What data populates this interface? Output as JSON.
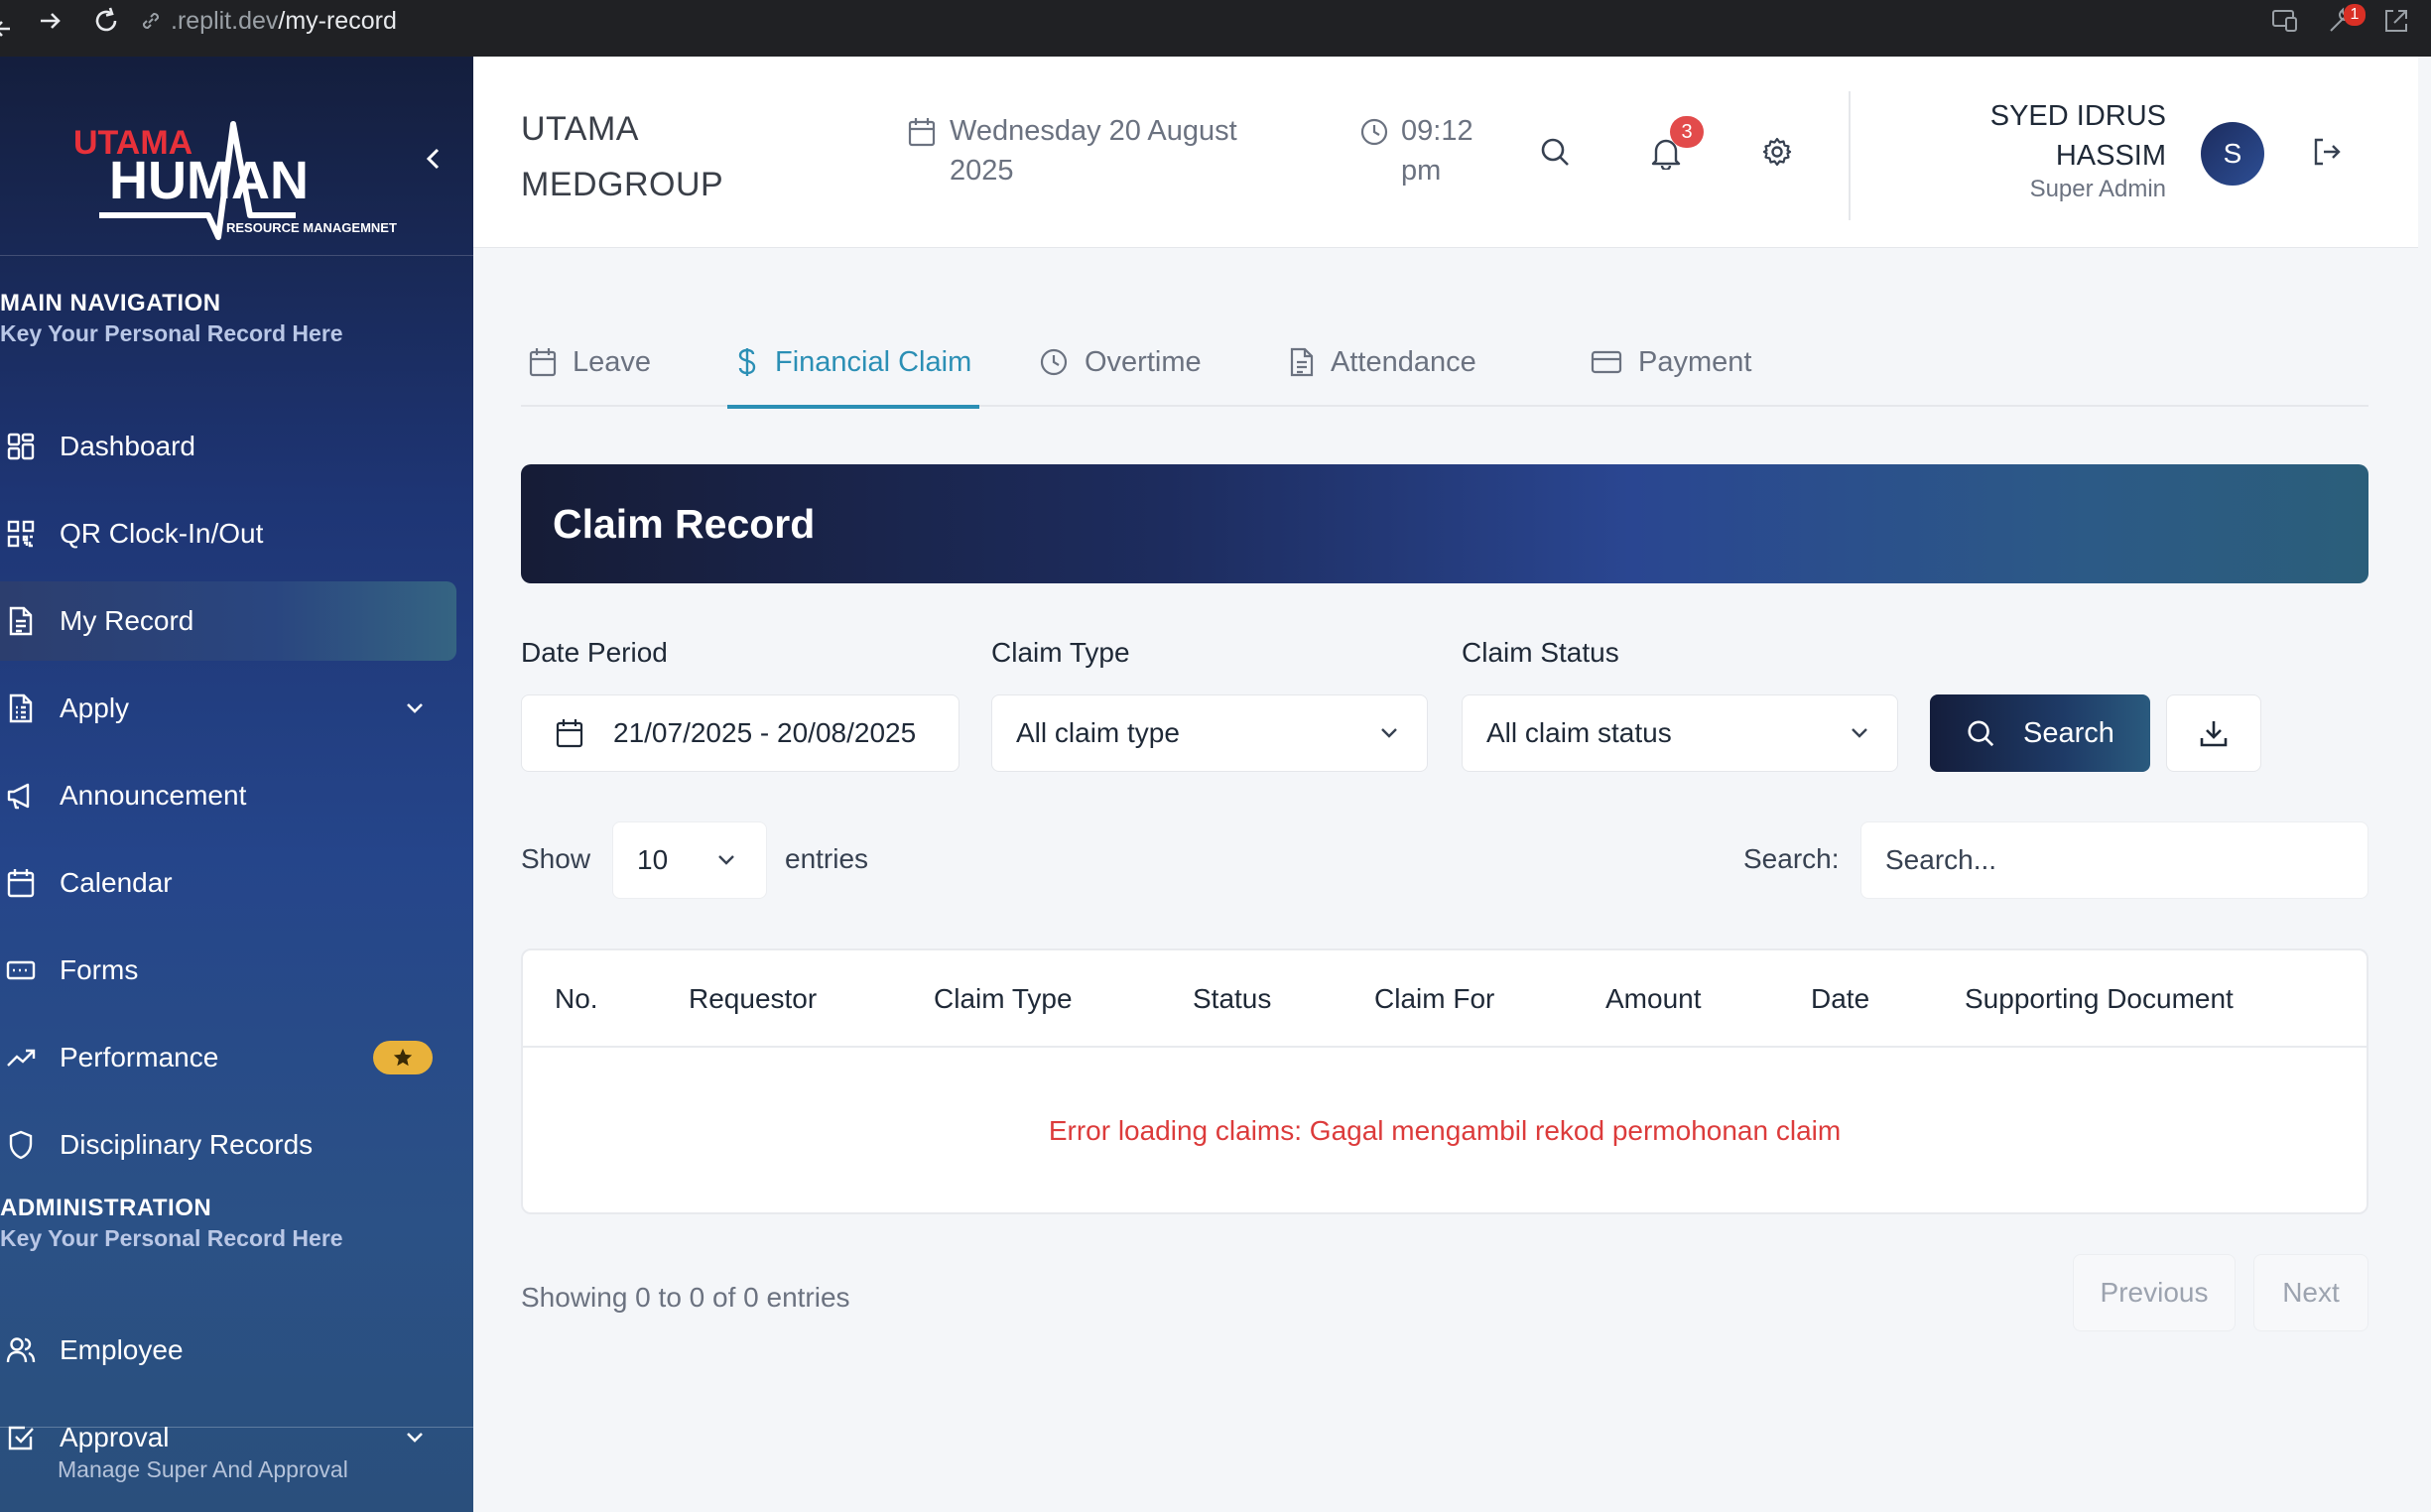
{
  "browser": {
    "url_host": ".replit.dev",
    "url_path": "/my-record",
    "extension_badge": "1"
  },
  "sidebar": {
    "logo": {
      "line1": "UTAMA",
      "line2": "HUMAN",
      "tagline": "RESOURCE MANAGEMNET"
    },
    "sections": [
      {
        "title": "MAIN NAVIGATION",
        "subtitle": "Key Your Personal Record Here"
      },
      {
        "title": "ADMINISTRATION",
        "subtitle": "Key Your Personal Record Here"
      }
    ],
    "items": [
      {
        "label": "Dashboard",
        "icon": "dashboard-icon"
      },
      {
        "label": "QR Clock-In/Out",
        "icon": "qr-code-icon"
      },
      {
        "label": "My Record",
        "icon": "document-icon",
        "active": true
      },
      {
        "label": "Apply",
        "icon": "file-list-icon",
        "has_submenu": true
      },
      {
        "label": "Announcement",
        "icon": "megaphone-icon"
      },
      {
        "label": "Calendar",
        "icon": "calendar-icon"
      },
      {
        "label": "Forms",
        "icon": "form-icon"
      },
      {
        "label": "Performance",
        "icon": "trending-up-icon",
        "badge": "star"
      },
      {
        "label": "Disciplinary Records",
        "icon": "shield-icon"
      }
    ],
    "admin_items": [
      {
        "label": "Employee",
        "icon": "users-icon"
      },
      {
        "label": "Approval",
        "icon": "check-square-icon",
        "has_submenu": true
      }
    ],
    "footer": "Manage Super And Approval"
  },
  "header": {
    "company_line1": "UTAMA",
    "company_line2": "MEDGROUP",
    "date_line1": "Wednesday 20 August",
    "date_line2": "2025",
    "time_line1": "09:12",
    "time_line2": "pm",
    "notification_count": "3",
    "user_name_line1": "SYED IDRUS",
    "user_name_line2": "HASSIM",
    "user_role": "Super Admin",
    "avatar_initial": "S"
  },
  "tabs": [
    {
      "label": "Leave",
      "icon": "calendar-icon"
    },
    {
      "label": "Financial Claim",
      "icon": "dollar-icon",
      "active": true
    },
    {
      "label": "Overtime",
      "icon": "clock-icon"
    },
    {
      "label": "Attendance",
      "icon": "document-icon"
    },
    {
      "label": "Payment",
      "icon": "credit-card-icon"
    }
  ],
  "banner": {
    "title": "Claim Record"
  },
  "filters": {
    "date_period_label": "Date Period",
    "date_period_value": "21/07/2025 - 20/08/2025",
    "claim_type_label": "Claim Type",
    "claim_type_value": "All claim type",
    "claim_status_label": "Claim Status",
    "claim_status_value": "All claim status",
    "search_button": "Search"
  },
  "table_controls": {
    "show_label": "Show",
    "page_size": "10",
    "entries_label": "entries",
    "search_label": "Search:",
    "search_placeholder": "Search..."
  },
  "table": {
    "columns": [
      "No.",
      "Requestor",
      "Claim Type",
      "Status",
      "Claim For",
      "Amount",
      "Date",
      "Supporting Document"
    ],
    "error_message": "Error loading claims: Gagal mengambil rekod permohonan claim"
  },
  "pagination": {
    "summary": "Showing 0 to 0 of 0 entries",
    "previous": "Previous",
    "next": "Next"
  },
  "colors": {
    "accent": "#2b8fb5",
    "error": "#dc3b3b",
    "badge": "#e24b4b",
    "star_badge": "#e9b23a"
  }
}
